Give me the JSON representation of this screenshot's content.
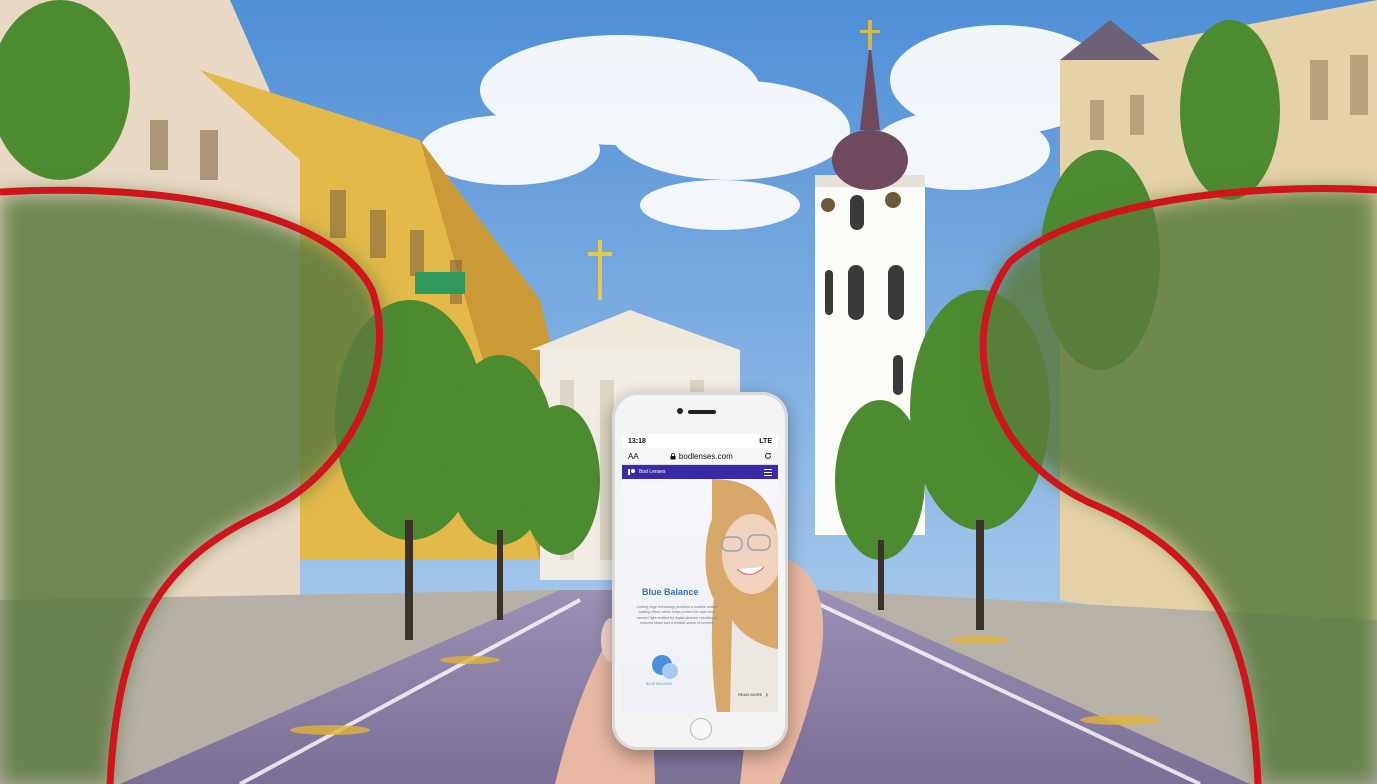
{
  "phone": {
    "time": "13:18",
    "signal": "LTE",
    "reader_mode": "AA",
    "url": "bodlenses.com",
    "reload_icon": "reload-icon",
    "lock_icon": "lock-icon",
    "brand": "Bod Lenses",
    "menu_icon": "hamburger-icon",
    "hero_title": "Blue Balance",
    "hero_text": "Cutting edge technology provides a durable coated coating effect, which helps protect the eyes from harmful light emitted by digital devices, resulting in reduced strain and a reliable sense of comfort.",
    "product_logo": "BLUE BALANCE",
    "read_more": "READ MORE"
  },
  "colors": {
    "overlay_curve": "#d0141b",
    "site_nav": "#3b2aa5",
    "accent_title": "#3a6fb8"
  }
}
